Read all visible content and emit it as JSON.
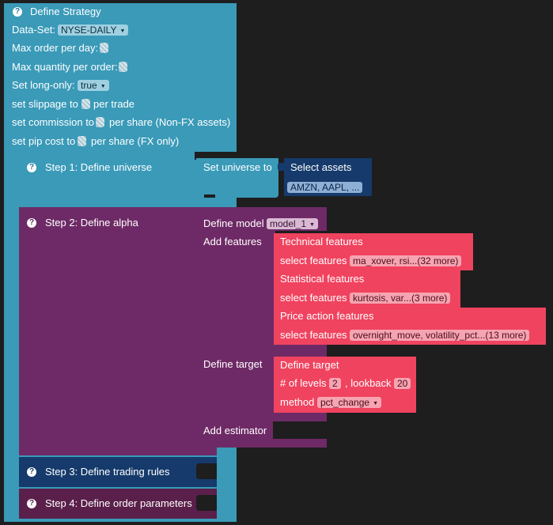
{
  "strategy": {
    "title": "Define Strategy",
    "dataset_label": "Data-Set:",
    "dataset_value": "NYSE-DAILY",
    "max_order_label": "Max order per day:",
    "max_qty_label": "Max quantity per order:",
    "long_only_label": "Set long-only:",
    "long_only_value": "true",
    "slippage_prefix": "set slippage to",
    "slippage_suffix": "per trade",
    "commission_prefix": "set commission to",
    "commission_suffix": "per share (Non-FX assets)",
    "pip_prefix": "set pip cost to",
    "pip_suffix": "per share (FX only)"
  },
  "step1": {
    "title": "Step 1: Define universe",
    "set_universe_label": "Set universe to",
    "select_assets_label": "Select assets",
    "assets_value": "AMZN, AAPL, ..."
  },
  "step2": {
    "title": "Step 2: Define alpha",
    "define_model_label": "Define model",
    "model_value": "model_1",
    "add_features_label": "Add features",
    "technical_title": "Technical features",
    "technical_select_label": "select features",
    "technical_value": "ma_xover, rsi...(32 more)",
    "statistical_title": "Statistical features",
    "statistical_select_label": "select features",
    "statistical_value": "kurtosis, var...(3 more)",
    "price_title": "Price action features",
    "price_select_label": "select features",
    "price_value": "overnight_move, volatility_pct...(13 more)",
    "define_target_label": "Define target",
    "target_block_title": "Define target",
    "levels_label": "# of levels",
    "levels_value": "2",
    "lookback_label": ", lookback",
    "lookback_value": "20",
    "method_label": "method",
    "method_value": "pct_change",
    "add_estimator_label": "Add estimator"
  },
  "step3": {
    "title": "Step 3: Define trading rules"
  },
  "step4": {
    "title": "Step 4: Define order parameters"
  },
  "icons": {
    "help": "?",
    "dropdown": "▼"
  },
  "colors": {
    "strategy": "#3a9ab8",
    "alpha": "#6e2a66",
    "features": "#f0435f",
    "assets": "#153a6b",
    "trading_rules": "#153a6b",
    "order_params": "#5a1f4a",
    "background": "#1e1e1e"
  }
}
